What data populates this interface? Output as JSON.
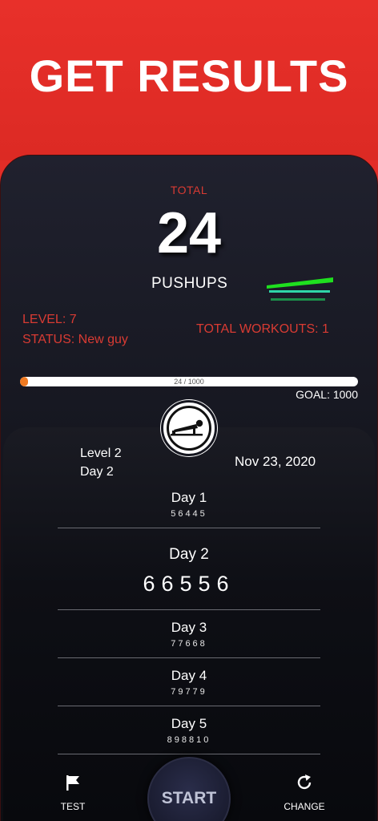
{
  "banner": {
    "title": "GET RESULTS"
  },
  "summary": {
    "total_label": "TOTAL",
    "total_value": "24",
    "unit_label": "PUSHUPS",
    "level": "LEVEL: 7",
    "status": "STATUS: New guy",
    "total_workouts": "TOTAL WORKOUTS: 1"
  },
  "progress": {
    "text": "24 / 1000",
    "current": 24,
    "goal_value": 1000,
    "goal_label": "GOAL: 1000",
    "fill_color": "#ef7a22"
  },
  "plan": {
    "level": "Level 2",
    "day": "Day 2",
    "date": "Nov 23, 2020",
    "avatar_icon": "pushup-figure-icon",
    "days": [
      {
        "name": "Day 1",
        "reps": "56445"
      },
      {
        "name": "Day 2",
        "reps": "66556",
        "current": true
      },
      {
        "name": "Day 3",
        "reps": "77668"
      },
      {
        "name": "Day 4",
        "reps": "79779"
      },
      {
        "name": "Day 5",
        "reps": "898810"
      }
    ]
  },
  "bottom_nav": {
    "test_label": "TEST",
    "test_icon": "flag-icon",
    "start_label": "START",
    "change_label": "CHANGE",
    "change_icon": "refresh-icon"
  },
  "colors": {
    "accent_red": "#e32d27",
    "stat_red": "#d93b33",
    "chart_green": "#1fe01f",
    "chart_teal": "#2fd6a8"
  }
}
